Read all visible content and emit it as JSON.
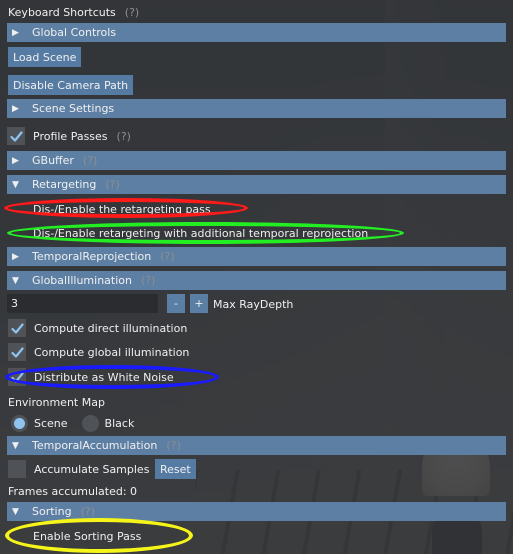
{
  "keyboard_shortcuts": {
    "label": "Keyboard Shortcuts",
    "help": "(?)"
  },
  "global_controls": {
    "label": "Global Controls",
    "expanded": false
  },
  "load_scene_button": "Load Scene",
  "disable_camera_path_button": "Disable Camera Path",
  "scene_settings": {
    "label": "Scene Settings",
    "expanded": false
  },
  "profile_passes": {
    "label": "Profile Passes",
    "help": "(?)",
    "checked": true
  },
  "gbuffer": {
    "label": "GBuffer",
    "help": "(?)",
    "expanded": false
  },
  "retargeting": {
    "label": "Retargeting",
    "help": "(?)",
    "expanded": true,
    "toggle_pass": "Dis-/Enable the retargeting pass",
    "toggle_temporal": "Dis-/Enable retargeting with additional temporal reprojection"
  },
  "temporal_reprojection": {
    "label": "TemporalReprojection",
    "help": "(?)",
    "expanded": false
  },
  "global_illumination": {
    "label": "GlobalIllumination",
    "help": "(?)",
    "expanded": true,
    "max_ray_depth_value": "3",
    "decrement": "-",
    "increment": "+",
    "max_ray_depth_label": "Max RayDepth",
    "compute_direct": {
      "label": "Compute direct illumination",
      "checked": true
    },
    "compute_global": {
      "label": "Compute global illumination",
      "checked": true
    },
    "distribute_white_noise": {
      "label": "Distribute as White Noise",
      "checked": true
    }
  },
  "environment_map": {
    "label": "Environment Map",
    "options": [
      "Scene",
      "Black"
    ],
    "selected": "Scene"
  },
  "temporal_accumulation": {
    "label": "TemporalAccumulation",
    "help": "(?)",
    "expanded": true,
    "accumulate_samples": {
      "label": "Accumulate Samples",
      "checked": false
    },
    "reset_button": "Reset",
    "frames_accumulated": "Frames accumulated: 0"
  },
  "sorting": {
    "label": "Sorting",
    "help": "(?)",
    "expanded": true,
    "enable_sorting_pass": "Enable Sorting Pass"
  },
  "colors": {
    "header": "#5d7fa3",
    "button": "#557ba3",
    "checkmark": "#8fc3f0",
    "annotation_red": "#ff1a1a",
    "annotation_green": "#22ee22",
    "annotation_blue": "#1a1aff",
    "annotation_yellow": "#f5f51a"
  }
}
